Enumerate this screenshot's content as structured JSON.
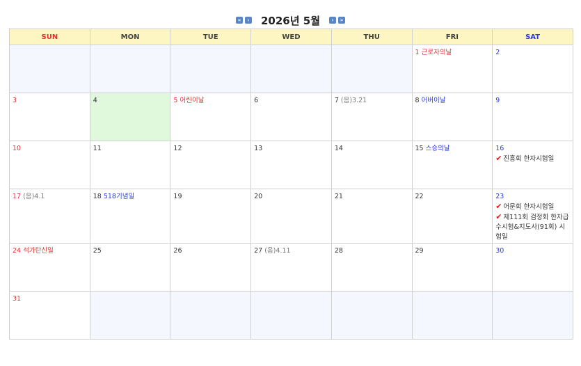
{
  "calendar": {
    "title": "2026년 5월",
    "nav": {
      "prev_year": "«",
      "prev_month": "‹",
      "next_month": "›",
      "next_year": "»"
    },
    "weekdays": [
      "SUN",
      "MON",
      "TUE",
      "WED",
      "THU",
      "FRI",
      "SAT"
    ],
    "days": {
      "d1": "1",
      "d1_note": "근로자의날",
      "d2": "2",
      "d3": "3",
      "d4": "4",
      "d5": "5",
      "d5_note": "어린이날",
      "d6": "6",
      "d7": "7",
      "d7_note": "(음)3.21",
      "d8": "8",
      "d8_note": "어버이날",
      "d9": "9",
      "d10": "10",
      "d11": "11",
      "d12": "12",
      "d13": "13",
      "d14": "14",
      "d15": "15",
      "d15_note": "스승의날",
      "d16": "16",
      "d16_event1": "진흥회 한자시험일",
      "d17": "17",
      "d17_note": "(음)4.1",
      "d18": "18",
      "d18_note": "518기념일",
      "d19": "19",
      "d20": "20",
      "d21": "21",
      "d22": "22",
      "d23": "23",
      "d23_event1": "어문회 한자시험일",
      "d23_event2": "제111회 검정회 한자급수시험&지도사(91회) 시험일",
      "d24": "24",
      "d24_note": "석가탄신일",
      "d25": "25",
      "d26": "26",
      "d27": "27",
      "d27_note": "(음)4.11",
      "d28": "28",
      "d29": "29",
      "d30": "30",
      "d31": "31"
    },
    "check_mark": "✔"
  },
  "colors": {
    "sunday": "#e52f2f",
    "saturday": "#2a3ad6",
    "header_bg": "#fdf6c3",
    "today_bg": "#e0f8dc",
    "empty_bg": "#f4f7fd"
  }
}
